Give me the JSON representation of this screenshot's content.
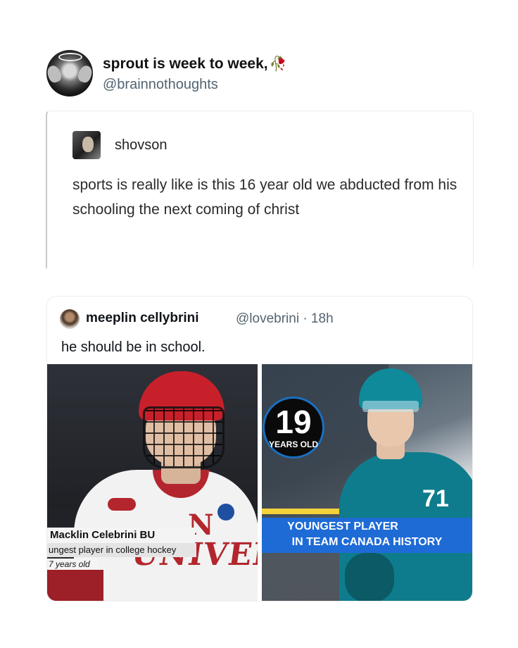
{
  "post": {
    "display_name": "sprout is week to week,",
    "display_name_icon": "rose-icon",
    "handle": "@brainnothoughts"
  },
  "reblog": {
    "username": "shovson",
    "text": "sports is really like is this 16 year old we abducted from his schooling the next coming of christ"
  },
  "tweet": {
    "name": "meeplin cellybrini",
    "meta": "@lovebrini · 18h",
    "text": "he should be in school."
  },
  "media_left": {
    "lower_third_name": "Macklin Celebrini BU",
    "lower_third_sub": "ungest player in college hockey",
    "lower_third_age": "7 years old",
    "jersey_lettering": "UNIVERSIT",
    "jersey_lettering_top": "N"
  },
  "media_right": {
    "badge_number": "19",
    "badge_label": "YEARS OLD",
    "jersey_number": "71",
    "banner_line1": "YOUNGEST PLAYER",
    "banner_line2": "IN TEAM CANADA HISTORY"
  },
  "colors": {
    "handle_gray": "#536471",
    "hockey_red": "#b3262d",
    "sharks_teal": "#0e7c8c",
    "banner_blue": "#1e6bd6"
  }
}
